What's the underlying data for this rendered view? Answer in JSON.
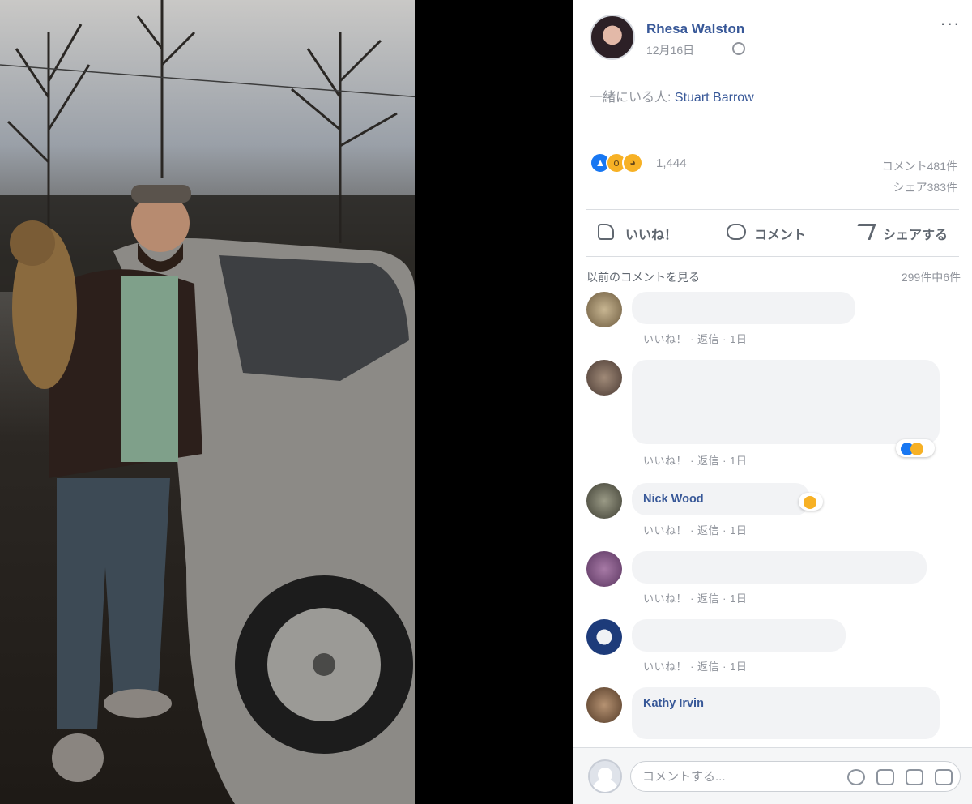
{
  "post": {
    "author_name": "Rhesa Walston",
    "date": "12月16日",
    "tagged_prefix": "一緒にいる人: ",
    "tagged_name": "Stuart Barrow",
    "reaction_count": "1,444",
    "comment_count": "コメント481件",
    "share_count": "シェア383件"
  },
  "actions": {
    "like": "いいね！",
    "comment": "コメント",
    "share": "シェアする"
  },
  "comments_header": {
    "view_previous": "以前のコメントを見る",
    "count": "299件中6件"
  },
  "comments": [
    {
      "name": "",
      "text": "",
      "meta": "いいね！ · 返信 · 1日"
    },
    {
      "name": "",
      "text": "",
      "meta": "いいね！ · 返信 · 1日"
    },
    {
      "name": "Nick Wood",
      "text": "",
      "meta": "いいね！ · 返信 · 1日"
    },
    {
      "name": "",
      "text": "",
      "meta": "いいね！ · 返信 · 1日"
    },
    {
      "name": "",
      "text": "",
      "meta": "いいね！ · 返信 · 1日"
    },
    {
      "name": "Kathy Irvin",
      "text": "",
      "meta": ""
    }
  ],
  "composer": {
    "placeholder": "コメントする..."
  },
  "colors": {
    "link": "#385898",
    "muted": "#90949c",
    "like_blue": "#1877f2",
    "emoji_yellow": "#f7b125"
  }
}
